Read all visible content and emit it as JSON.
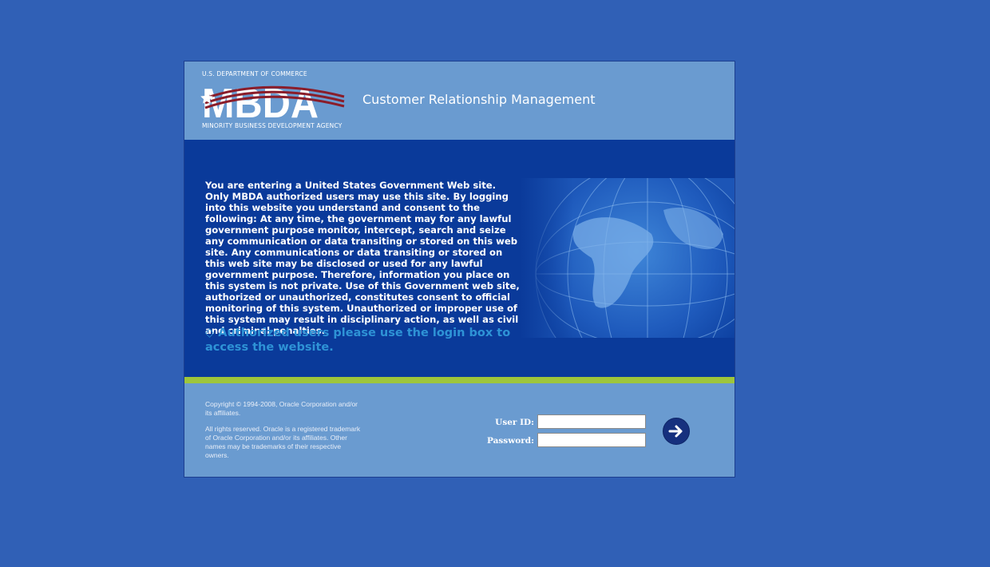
{
  "header": {
    "logo": {
      "department": "U.S. DEPARTMENT OF COMMERCE",
      "acronym": "MBDA",
      "agency": "MINORITY BUSINESS DEVELOPMENT AGENCY"
    },
    "app_title": "Customer Relationship Management"
  },
  "notice": {
    "text": "You are entering a United States Government Web site.  Only MBDA authorized users may use this site.  By logging into this website you understand and consent to the following:  At any time, the government may for any lawful government purpose monitor, intercept, search and seize any communication or data transiting or stored on this web site.  Any communications or data transiting or stored on this web site may be disclosed or used for any lawful government purpose.  Therefore, information you place on this system is not private. Use of this Government web site, authorized or unauthorized, constitutes consent to official monitoring of this system. Unauthorized or improper use of this system may result in disciplinary action, as well as civil and criminal penalties.",
    "callout_bullet": "◇",
    "callout_text": "Authorized users please use the login box to access the website."
  },
  "footer": {
    "copyright": "Copyright © 1994-2008, Oracle Corporation and/or its affiliates.",
    "rights": "All rights reserved. Oracle is a registered trademark of Oracle Corporation and/or its affiliates. Other names may be trademarks of their respective owners."
  },
  "login": {
    "user_id_label": "User ID:",
    "user_id_value": "",
    "password_label": "Password:",
    "password_value": "",
    "submit_icon": "arrow-right-icon"
  },
  "colors": {
    "page_background": "#3060b6",
    "panel_light": "#6a9bd0",
    "band_dark": "#0a3a9a",
    "accent_stripe": "#9ec63b",
    "callout_text": "#2e93d6",
    "button": "#16307e",
    "logo_swoosh": "#8a1d2a"
  }
}
